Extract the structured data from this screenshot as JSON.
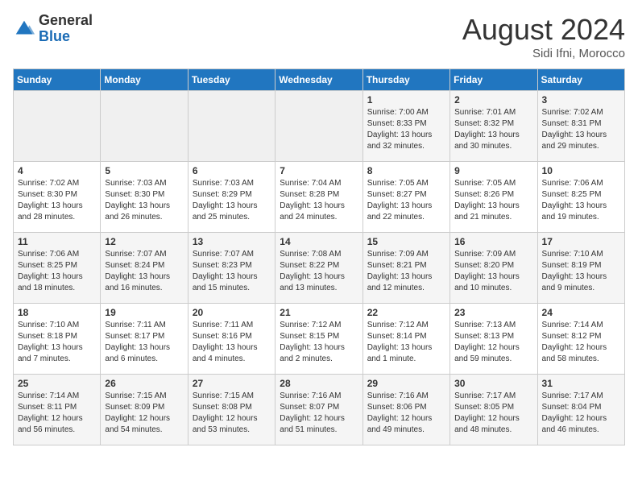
{
  "header": {
    "logo_general": "General",
    "logo_blue": "Blue",
    "month_year": "August 2024",
    "location": "Sidi Ifni, Morocco"
  },
  "days_of_week": [
    "Sunday",
    "Monday",
    "Tuesday",
    "Wednesday",
    "Thursday",
    "Friday",
    "Saturday"
  ],
  "weeks": [
    [
      {
        "day": "",
        "info": ""
      },
      {
        "day": "",
        "info": ""
      },
      {
        "day": "",
        "info": ""
      },
      {
        "day": "",
        "info": ""
      },
      {
        "day": "1",
        "info": "Sunrise: 7:00 AM\nSunset: 8:33 PM\nDaylight: 13 hours\nand 32 minutes."
      },
      {
        "day": "2",
        "info": "Sunrise: 7:01 AM\nSunset: 8:32 PM\nDaylight: 13 hours\nand 30 minutes."
      },
      {
        "day": "3",
        "info": "Sunrise: 7:02 AM\nSunset: 8:31 PM\nDaylight: 13 hours\nand 29 minutes."
      }
    ],
    [
      {
        "day": "4",
        "info": "Sunrise: 7:02 AM\nSunset: 8:30 PM\nDaylight: 13 hours\nand 28 minutes."
      },
      {
        "day": "5",
        "info": "Sunrise: 7:03 AM\nSunset: 8:30 PM\nDaylight: 13 hours\nand 26 minutes."
      },
      {
        "day": "6",
        "info": "Sunrise: 7:03 AM\nSunset: 8:29 PM\nDaylight: 13 hours\nand 25 minutes."
      },
      {
        "day": "7",
        "info": "Sunrise: 7:04 AM\nSunset: 8:28 PM\nDaylight: 13 hours\nand 24 minutes."
      },
      {
        "day": "8",
        "info": "Sunrise: 7:05 AM\nSunset: 8:27 PM\nDaylight: 13 hours\nand 22 minutes."
      },
      {
        "day": "9",
        "info": "Sunrise: 7:05 AM\nSunset: 8:26 PM\nDaylight: 13 hours\nand 21 minutes."
      },
      {
        "day": "10",
        "info": "Sunrise: 7:06 AM\nSunset: 8:25 PM\nDaylight: 13 hours\nand 19 minutes."
      }
    ],
    [
      {
        "day": "11",
        "info": "Sunrise: 7:06 AM\nSunset: 8:25 PM\nDaylight: 13 hours\nand 18 minutes."
      },
      {
        "day": "12",
        "info": "Sunrise: 7:07 AM\nSunset: 8:24 PM\nDaylight: 13 hours\nand 16 minutes."
      },
      {
        "day": "13",
        "info": "Sunrise: 7:07 AM\nSunset: 8:23 PM\nDaylight: 13 hours\nand 15 minutes."
      },
      {
        "day": "14",
        "info": "Sunrise: 7:08 AM\nSunset: 8:22 PM\nDaylight: 13 hours\nand 13 minutes."
      },
      {
        "day": "15",
        "info": "Sunrise: 7:09 AM\nSunset: 8:21 PM\nDaylight: 13 hours\nand 12 minutes."
      },
      {
        "day": "16",
        "info": "Sunrise: 7:09 AM\nSunset: 8:20 PM\nDaylight: 13 hours\nand 10 minutes."
      },
      {
        "day": "17",
        "info": "Sunrise: 7:10 AM\nSunset: 8:19 PM\nDaylight: 13 hours\nand 9 minutes."
      }
    ],
    [
      {
        "day": "18",
        "info": "Sunrise: 7:10 AM\nSunset: 8:18 PM\nDaylight: 13 hours\nand 7 minutes."
      },
      {
        "day": "19",
        "info": "Sunrise: 7:11 AM\nSunset: 8:17 PM\nDaylight: 13 hours\nand 6 minutes."
      },
      {
        "day": "20",
        "info": "Sunrise: 7:11 AM\nSunset: 8:16 PM\nDaylight: 13 hours\nand 4 minutes."
      },
      {
        "day": "21",
        "info": "Sunrise: 7:12 AM\nSunset: 8:15 PM\nDaylight: 13 hours\nand 2 minutes."
      },
      {
        "day": "22",
        "info": "Sunrise: 7:12 AM\nSunset: 8:14 PM\nDaylight: 13 hours\nand 1 minute."
      },
      {
        "day": "23",
        "info": "Sunrise: 7:13 AM\nSunset: 8:13 PM\nDaylight: 12 hours\nand 59 minutes."
      },
      {
        "day": "24",
        "info": "Sunrise: 7:14 AM\nSunset: 8:12 PM\nDaylight: 12 hours\nand 58 minutes."
      }
    ],
    [
      {
        "day": "25",
        "info": "Sunrise: 7:14 AM\nSunset: 8:11 PM\nDaylight: 12 hours\nand 56 minutes."
      },
      {
        "day": "26",
        "info": "Sunrise: 7:15 AM\nSunset: 8:09 PM\nDaylight: 12 hours\nand 54 minutes."
      },
      {
        "day": "27",
        "info": "Sunrise: 7:15 AM\nSunset: 8:08 PM\nDaylight: 12 hours\nand 53 minutes."
      },
      {
        "day": "28",
        "info": "Sunrise: 7:16 AM\nSunset: 8:07 PM\nDaylight: 12 hours\nand 51 minutes."
      },
      {
        "day": "29",
        "info": "Sunrise: 7:16 AM\nSunset: 8:06 PM\nDaylight: 12 hours\nand 49 minutes."
      },
      {
        "day": "30",
        "info": "Sunrise: 7:17 AM\nSunset: 8:05 PM\nDaylight: 12 hours\nand 48 minutes."
      },
      {
        "day": "31",
        "info": "Sunrise: 7:17 AM\nSunset: 8:04 PM\nDaylight: 12 hours\nand 46 minutes."
      }
    ]
  ]
}
